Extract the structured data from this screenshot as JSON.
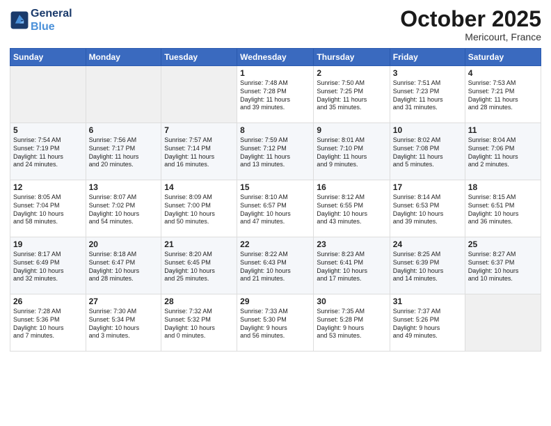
{
  "logo": {
    "line1": "General",
    "line2": "Blue"
  },
  "header": {
    "month": "October 2025",
    "location": "Mericourt, France"
  },
  "weekdays": [
    "Sunday",
    "Monday",
    "Tuesday",
    "Wednesday",
    "Thursday",
    "Friday",
    "Saturday"
  ],
  "weeks": [
    [
      {
        "day": "",
        "data": ""
      },
      {
        "day": "",
        "data": ""
      },
      {
        "day": "",
        "data": ""
      },
      {
        "day": "1",
        "data": "Sunrise: 7:48 AM\nSunset: 7:28 PM\nDaylight: 11 hours\nand 39 minutes."
      },
      {
        "day": "2",
        "data": "Sunrise: 7:50 AM\nSunset: 7:25 PM\nDaylight: 11 hours\nand 35 minutes."
      },
      {
        "day": "3",
        "data": "Sunrise: 7:51 AM\nSunset: 7:23 PM\nDaylight: 11 hours\nand 31 minutes."
      },
      {
        "day": "4",
        "data": "Sunrise: 7:53 AM\nSunset: 7:21 PM\nDaylight: 11 hours\nand 28 minutes."
      }
    ],
    [
      {
        "day": "5",
        "data": "Sunrise: 7:54 AM\nSunset: 7:19 PM\nDaylight: 11 hours\nand 24 minutes."
      },
      {
        "day": "6",
        "data": "Sunrise: 7:56 AM\nSunset: 7:17 PM\nDaylight: 11 hours\nand 20 minutes."
      },
      {
        "day": "7",
        "data": "Sunrise: 7:57 AM\nSunset: 7:14 PM\nDaylight: 11 hours\nand 16 minutes."
      },
      {
        "day": "8",
        "data": "Sunrise: 7:59 AM\nSunset: 7:12 PM\nDaylight: 11 hours\nand 13 minutes."
      },
      {
        "day": "9",
        "data": "Sunrise: 8:01 AM\nSunset: 7:10 PM\nDaylight: 11 hours\nand 9 minutes."
      },
      {
        "day": "10",
        "data": "Sunrise: 8:02 AM\nSunset: 7:08 PM\nDaylight: 11 hours\nand 5 minutes."
      },
      {
        "day": "11",
        "data": "Sunrise: 8:04 AM\nSunset: 7:06 PM\nDaylight: 11 hours\nand 2 minutes."
      }
    ],
    [
      {
        "day": "12",
        "data": "Sunrise: 8:05 AM\nSunset: 7:04 PM\nDaylight: 10 hours\nand 58 minutes."
      },
      {
        "day": "13",
        "data": "Sunrise: 8:07 AM\nSunset: 7:02 PM\nDaylight: 10 hours\nand 54 minutes."
      },
      {
        "day": "14",
        "data": "Sunrise: 8:09 AM\nSunset: 7:00 PM\nDaylight: 10 hours\nand 50 minutes."
      },
      {
        "day": "15",
        "data": "Sunrise: 8:10 AM\nSunset: 6:57 PM\nDaylight: 10 hours\nand 47 minutes."
      },
      {
        "day": "16",
        "data": "Sunrise: 8:12 AM\nSunset: 6:55 PM\nDaylight: 10 hours\nand 43 minutes."
      },
      {
        "day": "17",
        "data": "Sunrise: 8:14 AM\nSunset: 6:53 PM\nDaylight: 10 hours\nand 39 minutes."
      },
      {
        "day": "18",
        "data": "Sunrise: 8:15 AM\nSunset: 6:51 PM\nDaylight: 10 hours\nand 36 minutes."
      }
    ],
    [
      {
        "day": "19",
        "data": "Sunrise: 8:17 AM\nSunset: 6:49 PM\nDaylight: 10 hours\nand 32 minutes."
      },
      {
        "day": "20",
        "data": "Sunrise: 8:18 AM\nSunset: 6:47 PM\nDaylight: 10 hours\nand 28 minutes."
      },
      {
        "day": "21",
        "data": "Sunrise: 8:20 AM\nSunset: 6:45 PM\nDaylight: 10 hours\nand 25 minutes."
      },
      {
        "day": "22",
        "data": "Sunrise: 8:22 AM\nSunset: 6:43 PM\nDaylight: 10 hours\nand 21 minutes."
      },
      {
        "day": "23",
        "data": "Sunrise: 8:23 AM\nSunset: 6:41 PM\nDaylight: 10 hours\nand 17 minutes."
      },
      {
        "day": "24",
        "data": "Sunrise: 8:25 AM\nSunset: 6:39 PM\nDaylight: 10 hours\nand 14 minutes."
      },
      {
        "day": "25",
        "data": "Sunrise: 8:27 AM\nSunset: 6:37 PM\nDaylight: 10 hours\nand 10 minutes."
      }
    ],
    [
      {
        "day": "26",
        "data": "Sunrise: 7:28 AM\nSunset: 5:36 PM\nDaylight: 10 hours\nand 7 minutes."
      },
      {
        "day": "27",
        "data": "Sunrise: 7:30 AM\nSunset: 5:34 PM\nDaylight: 10 hours\nand 3 minutes."
      },
      {
        "day": "28",
        "data": "Sunrise: 7:32 AM\nSunset: 5:32 PM\nDaylight: 10 hours\nand 0 minutes."
      },
      {
        "day": "29",
        "data": "Sunrise: 7:33 AM\nSunset: 5:30 PM\nDaylight: 9 hours\nand 56 minutes."
      },
      {
        "day": "30",
        "data": "Sunrise: 7:35 AM\nSunset: 5:28 PM\nDaylight: 9 hours\nand 53 minutes."
      },
      {
        "day": "31",
        "data": "Sunrise: 7:37 AM\nSunset: 5:26 PM\nDaylight: 9 hours\nand 49 minutes."
      },
      {
        "day": "",
        "data": ""
      }
    ]
  ]
}
